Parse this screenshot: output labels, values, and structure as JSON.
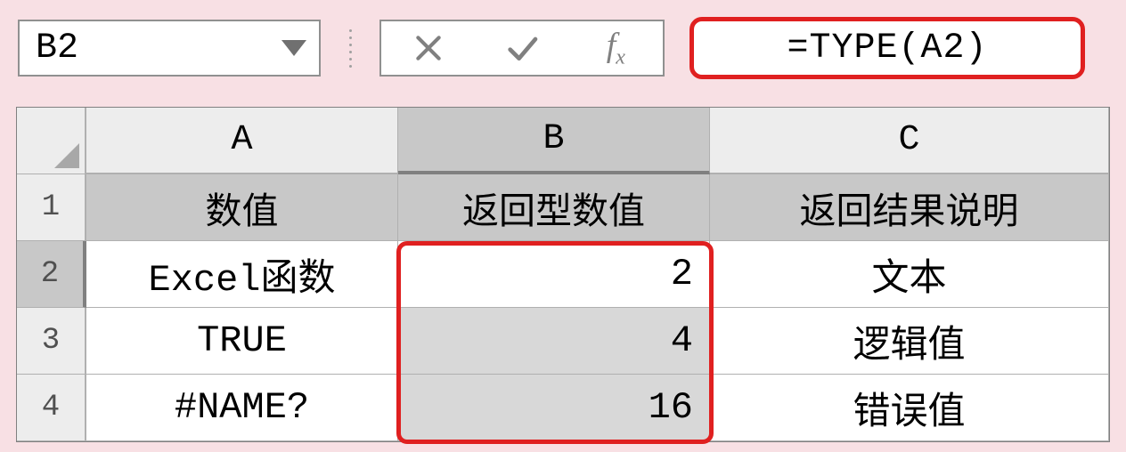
{
  "formula_bar": {
    "cell_ref": "B2",
    "formula": "=TYPE(A2)"
  },
  "columns": {
    "A": "A",
    "B": "B",
    "C": "C"
  },
  "rows": {
    "r1": "1",
    "r2": "2",
    "r3": "3",
    "r4": "4"
  },
  "header": {
    "A": "数值",
    "B": "返回型数值",
    "C": "返回结果说明"
  },
  "data": [
    {
      "A": "Excel函数",
      "B": "2",
      "C": "文本"
    },
    {
      "A": "TRUE",
      "B": "4",
      "C": "逻辑值"
    },
    {
      "A": "#NAME?",
      "B": "16",
      "C": "错误值"
    }
  ],
  "icons": {
    "cancel": "cancel-icon",
    "accept": "accept-icon",
    "fx": "fx-icon",
    "dropdown": "dropdown-icon",
    "select_all": "select-all-icon"
  }
}
